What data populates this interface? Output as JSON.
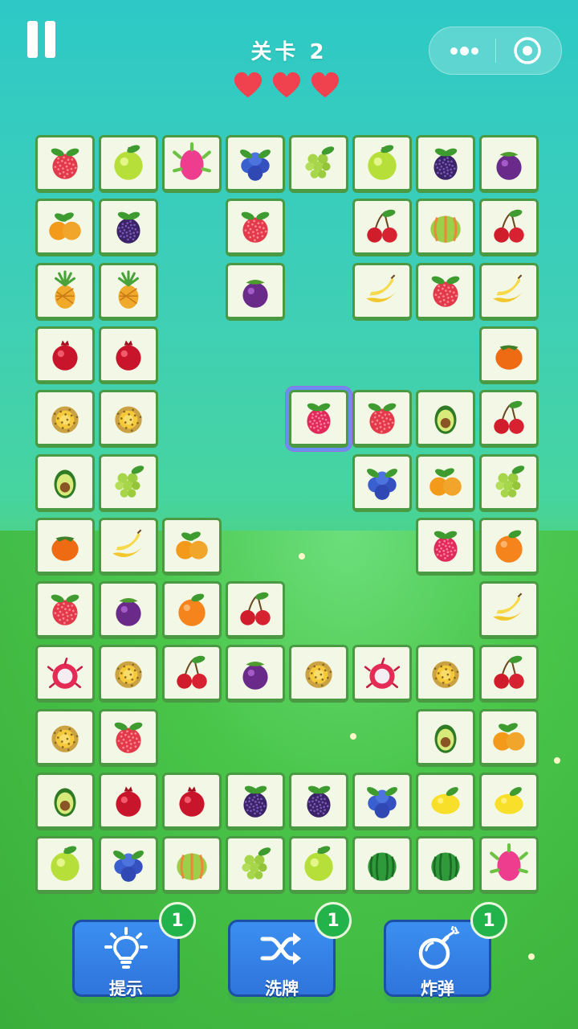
{
  "header": {
    "level_title": "关卡 2",
    "hearts": 3
  },
  "board": {
    "rows": [
      [
        "lychee",
        "apple",
        "dragonfruit",
        "blueberry",
        "grape",
        "apple",
        "blackberry",
        "mangosteen"
      ],
      [
        "kumquat",
        "blackberry",
        "",
        "lychee",
        "",
        "cherry",
        "melon",
        "cherry"
      ],
      [
        "pineapple",
        "pineapple",
        "",
        "mangosteen",
        "",
        "banana",
        "lychee",
        "banana"
      ],
      [
        "pomegranate",
        "pomegranate",
        "",
        "",
        "",
        "",
        "",
        "persimmon"
      ],
      [
        "durian",
        "durian",
        "",
        "",
        "raspberry",
        "lychee",
        "avocado",
        "cherry"
      ],
      [
        "avocado",
        "grape",
        "",
        "",
        "",
        "blueberry",
        "kumquat",
        "grape"
      ],
      [
        "persimmon",
        "banana",
        "kumquat",
        "",
        "",
        "",
        "raspberry",
        "orange"
      ],
      [
        "lychee",
        "mangosteen",
        "orange",
        "cherry",
        "",
        "",
        "",
        "banana"
      ],
      [
        "rambutan",
        "durian",
        "cherry",
        "mangosteen",
        "durian",
        "rambutan",
        "durian",
        "cherry"
      ],
      [
        "durian",
        "lychee",
        "",
        "",
        "",
        "",
        "avocado",
        "kumquat"
      ],
      [
        "avocado",
        "pomegranate",
        "pomegranate",
        "blackberry",
        "blackberry",
        "blueberry",
        "lemon",
        "lemon"
      ],
      [
        "apple",
        "blueberry",
        "melon",
        "grape",
        "apple",
        "watermelon",
        "watermelon",
        "dragonfruit"
      ]
    ],
    "selected": {
      "row": 4,
      "col": 4
    }
  },
  "toolbar": {
    "hint": {
      "label": "提示",
      "count": "1",
      "icon": "lightbulb-icon"
    },
    "shuffle": {
      "label": "洗牌",
      "count": "1",
      "icon": "shuffle-icon"
    },
    "bomb": {
      "label": "炸弹",
      "count": "1",
      "icon": "bomb-icon"
    }
  },
  "colors": {
    "tile_bg": "#f3f8e6",
    "tile_border": "#4a9a44",
    "button_blue": "#3b8ff0",
    "badge_green": "#22b34a",
    "heart_red": "#f0424e"
  }
}
